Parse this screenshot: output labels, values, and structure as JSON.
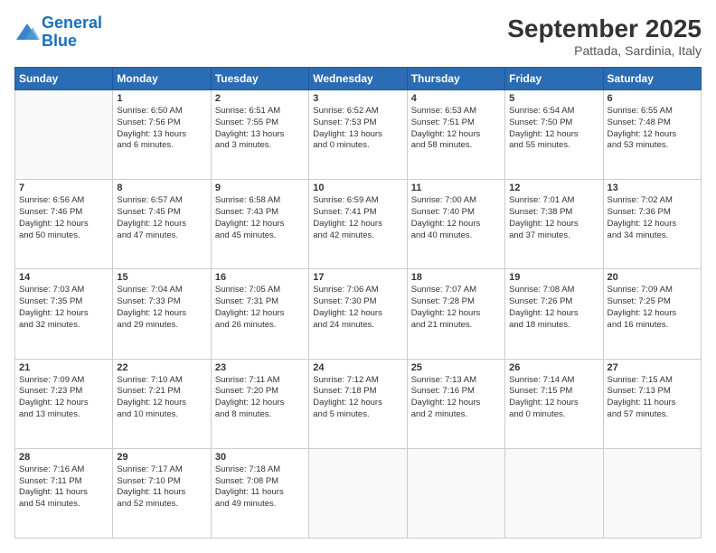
{
  "header": {
    "logo_line1": "General",
    "logo_line2": "Blue",
    "month": "September 2025",
    "location": "Pattada, Sardinia, Italy"
  },
  "days_of_week": [
    "Sunday",
    "Monday",
    "Tuesday",
    "Wednesday",
    "Thursday",
    "Friday",
    "Saturday"
  ],
  "weeks": [
    [
      {
        "day": "",
        "info": ""
      },
      {
        "day": "1",
        "info": "Sunrise: 6:50 AM\nSunset: 7:56 PM\nDaylight: 13 hours\nand 6 minutes."
      },
      {
        "day": "2",
        "info": "Sunrise: 6:51 AM\nSunset: 7:55 PM\nDaylight: 13 hours\nand 3 minutes."
      },
      {
        "day": "3",
        "info": "Sunrise: 6:52 AM\nSunset: 7:53 PM\nDaylight: 13 hours\nand 0 minutes."
      },
      {
        "day": "4",
        "info": "Sunrise: 6:53 AM\nSunset: 7:51 PM\nDaylight: 12 hours\nand 58 minutes."
      },
      {
        "day": "5",
        "info": "Sunrise: 6:54 AM\nSunset: 7:50 PM\nDaylight: 12 hours\nand 55 minutes."
      },
      {
        "day": "6",
        "info": "Sunrise: 6:55 AM\nSunset: 7:48 PM\nDaylight: 12 hours\nand 53 minutes."
      }
    ],
    [
      {
        "day": "7",
        "info": "Sunrise: 6:56 AM\nSunset: 7:46 PM\nDaylight: 12 hours\nand 50 minutes."
      },
      {
        "day": "8",
        "info": "Sunrise: 6:57 AM\nSunset: 7:45 PM\nDaylight: 12 hours\nand 47 minutes."
      },
      {
        "day": "9",
        "info": "Sunrise: 6:58 AM\nSunset: 7:43 PM\nDaylight: 12 hours\nand 45 minutes."
      },
      {
        "day": "10",
        "info": "Sunrise: 6:59 AM\nSunset: 7:41 PM\nDaylight: 12 hours\nand 42 minutes."
      },
      {
        "day": "11",
        "info": "Sunrise: 7:00 AM\nSunset: 7:40 PM\nDaylight: 12 hours\nand 40 minutes."
      },
      {
        "day": "12",
        "info": "Sunrise: 7:01 AM\nSunset: 7:38 PM\nDaylight: 12 hours\nand 37 minutes."
      },
      {
        "day": "13",
        "info": "Sunrise: 7:02 AM\nSunset: 7:36 PM\nDaylight: 12 hours\nand 34 minutes."
      }
    ],
    [
      {
        "day": "14",
        "info": "Sunrise: 7:03 AM\nSunset: 7:35 PM\nDaylight: 12 hours\nand 32 minutes."
      },
      {
        "day": "15",
        "info": "Sunrise: 7:04 AM\nSunset: 7:33 PM\nDaylight: 12 hours\nand 29 minutes."
      },
      {
        "day": "16",
        "info": "Sunrise: 7:05 AM\nSunset: 7:31 PM\nDaylight: 12 hours\nand 26 minutes."
      },
      {
        "day": "17",
        "info": "Sunrise: 7:06 AM\nSunset: 7:30 PM\nDaylight: 12 hours\nand 24 minutes."
      },
      {
        "day": "18",
        "info": "Sunrise: 7:07 AM\nSunset: 7:28 PM\nDaylight: 12 hours\nand 21 minutes."
      },
      {
        "day": "19",
        "info": "Sunrise: 7:08 AM\nSunset: 7:26 PM\nDaylight: 12 hours\nand 18 minutes."
      },
      {
        "day": "20",
        "info": "Sunrise: 7:09 AM\nSunset: 7:25 PM\nDaylight: 12 hours\nand 16 minutes."
      }
    ],
    [
      {
        "day": "21",
        "info": "Sunrise: 7:09 AM\nSunset: 7:23 PM\nDaylight: 12 hours\nand 13 minutes."
      },
      {
        "day": "22",
        "info": "Sunrise: 7:10 AM\nSunset: 7:21 PM\nDaylight: 12 hours\nand 10 minutes."
      },
      {
        "day": "23",
        "info": "Sunrise: 7:11 AM\nSunset: 7:20 PM\nDaylight: 12 hours\nand 8 minutes."
      },
      {
        "day": "24",
        "info": "Sunrise: 7:12 AM\nSunset: 7:18 PM\nDaylight: 12 hours\nand 5 minutes."
      },
      {
        "day": "25",
        "info": "Sunrise: 7:13 AM\nSunset: 7:16 PM\nDaylight: 12 hours\nand 2 minutes."
      },
      {
        "day": "26",
        "info": "Sunrise: 7:14 AM\nSunset: 7:15 PM\nDaylight: 12 hours\nand 0 minutes."
      },
      {
        "day": "27",
        "info": "Sunrise: 7:15 AM\nSunset: 7:13 PM\nDaylight: 11 hours\nand 57 minutes."
      }
    ],
    [
      {
        "day": "28",
        "info": "Sunrise: 7:16 AM\nSunset: 7:11 PM\nDaylight: 11 hours\nand 54 minutes."
      },
      {
        "day": "29",
        "info": "Sunrise: 7:17 AM\nSunset: 7:10 PM\nDaylight: 11 hours\nand 52 minutes."
      },
      {
        "day": "30",
        "info": "Sunrise: 7:18 AM\nSunset: 7:08 PM\nDaylight: 11 hours\nand 49 minutes."
      },
      {
        "day": "",
        "info": ""
      },
      {
        "day": "",
        "info": ""
      },
      {
        "day": "",
        "info": ""
      },
      {
        "day": "",
        "info": ""
      }
    ]
  ]
}
